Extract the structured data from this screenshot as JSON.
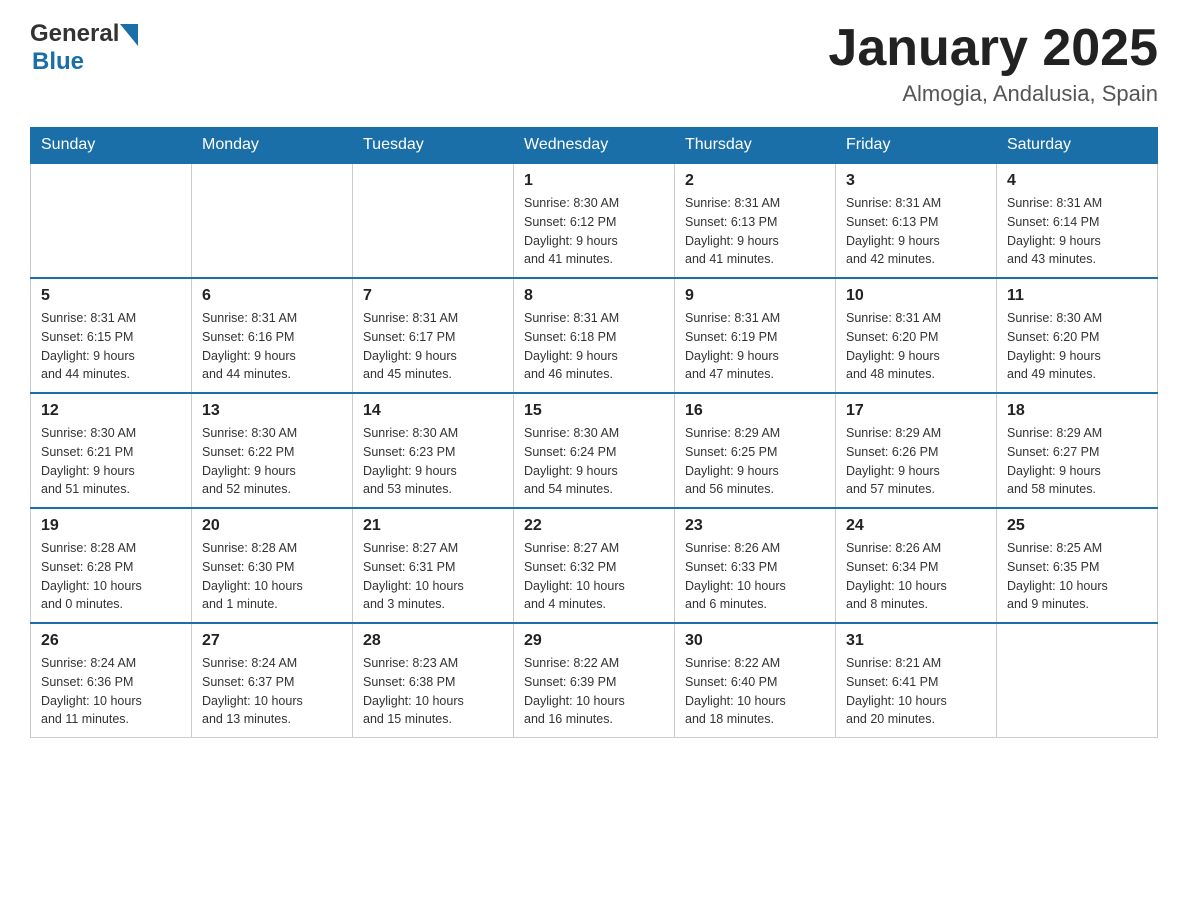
{
  "header": {
    "logo_general": "General",
    "logo_blue": "Blue",
    "title": "January 2025",
    "subtitle": "Almogia, Andalusia, Spain"
  },
  "weekdays": [
    "Sunday",
    "Monday",
    "Tuesday",
    "Wednesday",
    "Thursday",
    "Friday",
    "Saturday"
  ],
  "weeks": [
    [
      {
        "day": "",
        "info": ""
      },
      {
        "day": "",
        "info": ""
      },
      {
        "day": "",
        "info": ""
      },
      {
        "day": "1",
        "info": "Sunrise: 8:30 AM\nSunset: 6:12 PM\nDaylight: 9 hours\nand 41 minutes."
      },
      {
        "day": "2",
        "info": "Sunrise: 8:31 AM\nSunset: 6:13 PM\nDaylight: 9 hours\nand 41 minutes."
      },
      {
        "day": "3",
        "info": "Sunrise: 8:31 AM\nSunset: 6:13 PM\nDaylight: 9 hours\nand 42 minutes."
      },
      {
        "day": "4",
        "info": "Sunrise: 8:31 AM\nSunset: 6:14 PM\nDaylight: 9 hours\nand 43 minutes."
      }
    ],
    [
      {
        "day": "5",
        "info": "Sunrise: 8:31 AM\nSunset: 6:15 PM\nDaylight: 9 hours\nand 44 minutes."
      },
      {
        "day": "6",
        "info": "Sunrise: 8:31 AM\nSunset: 6:16 PM\nDaylight: 9 hours\nand 44 minutes."
      },
      {
        "day": "7",
        "info": "Sunrise: 8:31 AM\nSunset: 6:17 PM\nDaylight: 9 hours\nand 45 minutes."
      },
      {
        "day": "8",
        "info": "Sunrise: 8:31 AM\nSunset: 6:18 PM\nDaylight: 9 hours\nand 46 minutes."
      },
      {
        "day": "9",
        "info": "Sunrise: 8:31 AM\nSunset: 6:19 PM\nDaylight: 9 hours\nand 47 minutes."
      },
      {
        "day": "10",
        "info": "Sunrise: 8:31 AM\nSunset: 6:20 PM\nDaylight: 9 hours\nand 48 minutes."
      },
      {
        "day": "11",
        "info": "Sunrise: 8:30 AM\nSunset: 6:20 PM\nDaylight: 9 hours\nand 49 minutes."
      }
    ],
    [
      {
        "day": "12",
        "info": "Sunrise: 8:30 AM\nSunset: 6:21 PM\nDaylight: 9 hours\nand 51 minutes."
      },
      {
        "day": "13",
        "info": "Sunrise: 8:30 AM\nSunset: 6:22 PM\nDaylight: 9 hours\nand 52 minutes."
      },
      {
        "day": "14",
        "info": "Sunrise: 8:30 AM\nSunset: 6:23 PM\nDaylight: 9 hours\nand 53 minutes."
      },
      {
        "day": "15",
        "info": "Sunrise: 8:30 AM\nSunset: 6:24 PM\nDaylight: 9 hours\nand 54 minutes."
      },
      {
        "day": "16",
        "info": "Sunrise: 8:29 AM\nSunset: 6:25 PM\nDaylight: 9 hours\nand 56 minutes."
      },
      {
        "day": "17",
        "info": "Sunrise: 8:29 AM\nSunset: 6:26 PM\nDaylight: 9 hours\nand 57 minutes."
      },
      {
        "day": "18",
        "info": "Sunrise: 8:29 AM\nSunset: 6:27 PM\nDaylight: 9 hours\nand 58 minutes."
      }
    ],
    [
      {
        "day": "19",
        "info": "Sunrise: 8:28 AM\nSunset: 6:28 PM\nDaylight: 10 hours\nand 0 minutes."
      },
      {
        "day": "20",
        "info": "Sunrise: 8:28 AM\nSunset: 6:30 PM\nDaylight: 10 hours\nand 1 minute."
      },
      {
        "day": "21",
        "info": "Sunrise: 8:27 AM\nSunset: 6:31 PM\nDaylight: 10 hours\nand 3 minutes."
      },
      {
        "day": "22",
        "info": "Sunrise: 8:27 AM\nSunset: 6:32 PM\nDaylight: 10 hours\nand 4 minutes."
      },
      {
        "day": "23",
        "info": "Sunrise: 8:26 AM\nSunset: 6:33 PM\nDaylight: 10 hours\nand 6 minutes."
      },
      {
        "day": "24",
        "info": "Sunrise: 8:26 AM\nSunset: 6:34 PM\nDaylight: 10 hours\nand 8 minutes."
      },
      {
        "day": "25",
        "info": "Sunrise: 8:25 AM\nSunset: 6:35 PM\nDaylight: 10 hours\nand 9 minutes."
      }
    ],
    [
      {
        "day": "26",
        "info": "Sunrise: 8:24 AM\nSunset: 6:36 PM\nDaylight: 10 hours\nand 11 minutes."
      },
      {
        "day": "27",
        "info": "Sunrise: 8:24 AM\nSunset: 6:37 PM\nDaylight: 10 hours\nand 13 minutes."
      },
      {
        "day": "28",
        "info": "Sunrise: 8:23 AM\nSunset: 6:38 PM\nDaylight: 10 hours\nand 15 minutes."
      },
      {
        "day": "29",
        "info": "Sunrise: 8:22 AM\nSunset: 6:39 PM\nDaylight: 10 hours\nand 16 minutes."
      },
      {
        "day": "30",
        "info": "Sunrise: 8:22 AM\nSunset: 6:40 PM\nDaylight: 10 hours\nand 18 minutes."
      },
      {
        "day": "31",
        "info": "Sunrise: 8:21 AM\nSunset: 6:41 PM\nDaylight: 10 hours\nand 20 minutes."
      },
      {
        "day": "",
        "info": ""
      }
    ]
  ]
}
